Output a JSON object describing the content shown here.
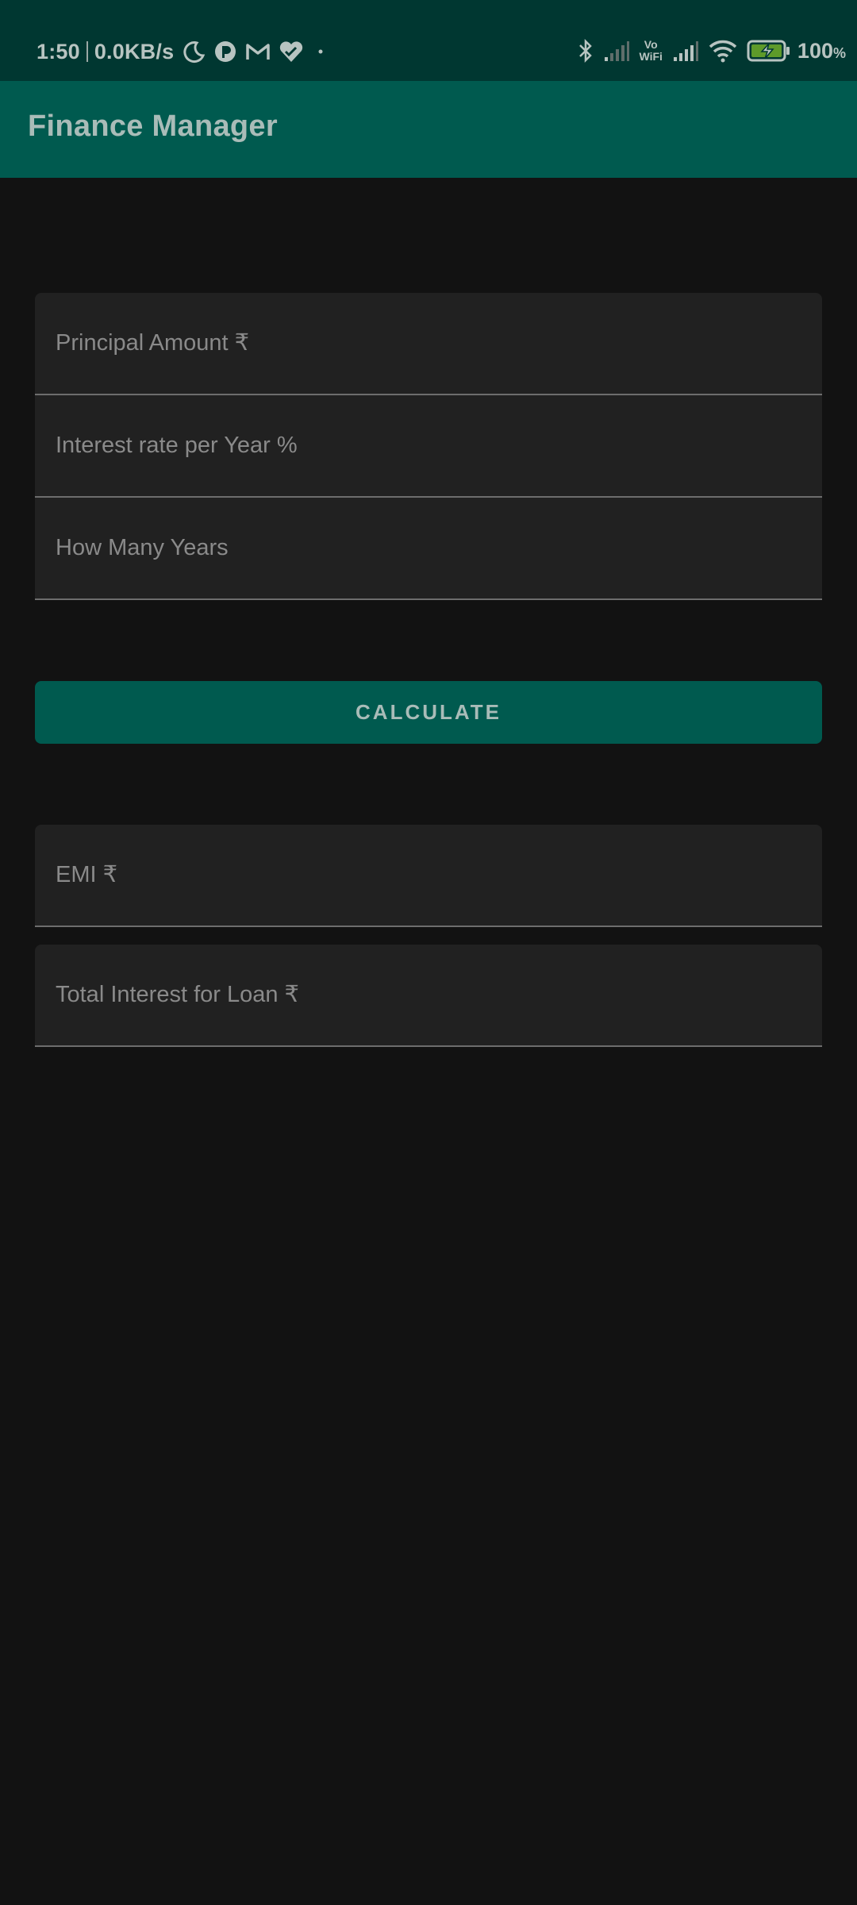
{
  "status_bar": {
    "time": "1:50",
    "network_speed": "0.0KB/s",
    "left_icons": [
      "moon-icon",
      "notification-app-icon",
      "gmail-icon",
      "heart-icon",
      "dot-icon"
    ],
    "right_icons": [
      "bluetooth-icon",
      "signal-icon",
      "vowifi-icon",
      "signal-icon",
      "wifi-icon",
      "battery-charging-icon"
    ],
    "vowifi_label_top": "Vo",
    "vowifi_label_bottom": "WiFi",
    "battery_level": "100",
    "battery_unit": "%"
  },
  "app_bar": {
    "title": "Finance Manager"
  },
  "form": {
    "principal_placeholder": "Principal Amount ₹",
    "interest_placeholder": "Interest rate per Year %",
    "years_placeholder": "How Many Years"
  },
  "calculate_button": {
    "label": "CALCULATE"
  },
  "results": {
    "emi_placeholder": "EMI ₹",
    "total_interest_placeholder": "Total Interest for Loan ₹"
  },
  "colors": {
    "status_bar": "#003731",
    "app_bar": "#005a4f",
    "background": "#121212",
    "field_background": "#212121",
    "button": "#005a4f"
  }
}
